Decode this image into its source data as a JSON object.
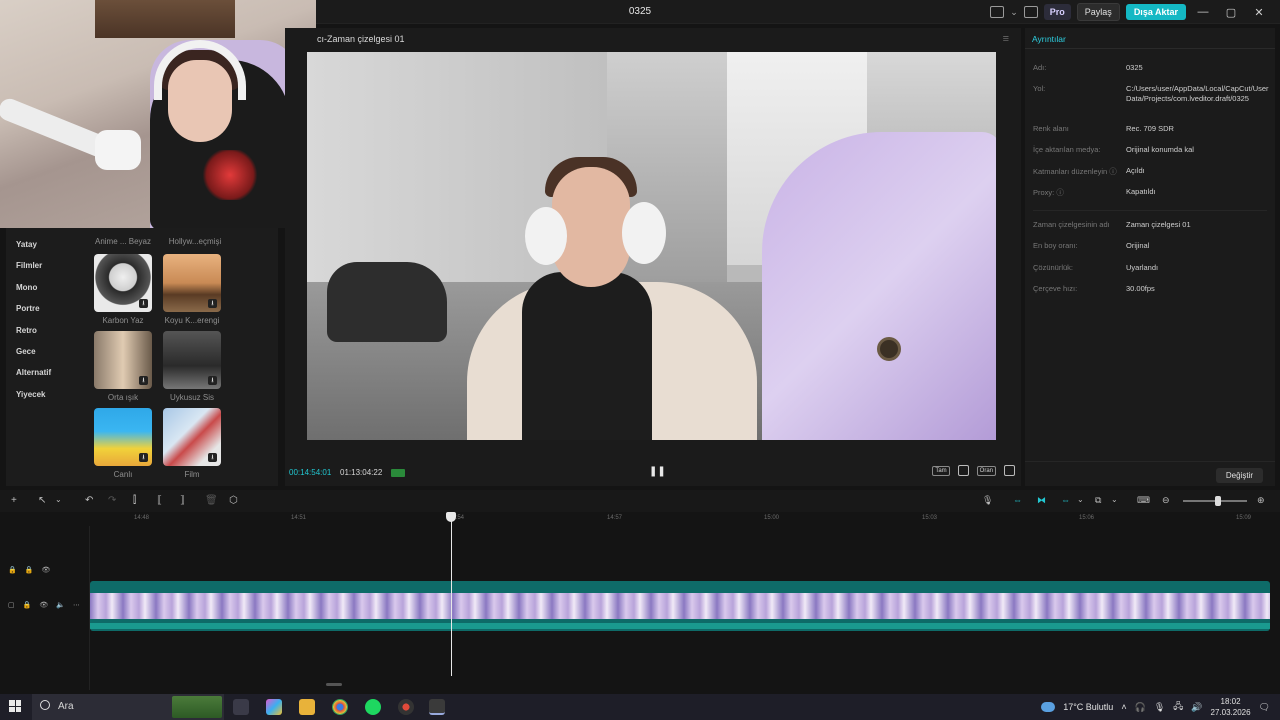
{
  "window": {
    "title": "0325",
    "pro_label": "Pro",
    "share_label": "Paylaş",
    "export_label": "Dışa Aktar",
    "minimize": "—",
    "maximize": "▢",
    "close": "✕"
  },
  "filters": {
    "categories": [
      "Yatay",
      "Filmler",
      "Mono",
      "Portre",
      "Retro",
      "Gece",
      "Alternatif",
      "Yiyecek"
    ],
    "top_labels": [
      "Anime ... Beyaz",
      "Hollyw...eçmişi"
    ],
    "items": [
      {
        "label": "Karbon Yaz",
        "download": "⭳"
      },
      {
        "label": "Koyu K...erengi",
        "download": "⭳"
      },
      {
        "label": "Orta ışık",
        "download": "⭳"
      },
      {
        "label": "Uykusuz Sis",
        "download": "⭳"
      },
      {
        "label": "Canlı",
        "download": "⭳"
      },
      {
        "label": "Film",
        "download": "⭳"
      }
    ]
  },
  "player": {
    "title": "cı-Zaman çizelgesi 01",
    "current_time": "00:14:54:01",
    "total_time": "01:13:04:22",
    "pause_icon": "❚❚",
    "controls": [
      "Tam",
      "Oran"
    ]
  },
  "details": {
    "title": "Ayrıntılar",
    "rows": [
      {
        "key": "Adı:",
        "value": "0325"
      },
      {
        "key": "Yol:",
        "value": "C:/Users/user/AppData/Local/CapCut/User Data/Projects/com.lveditor.draft/0325"
      },
      {
        "key": "Renk alanı",
        "value": "Rec. 709 SDR"
      },
      {
        "key": "İçe aktarılan medya:",
        "value": "Orijinal konumda kal"
      },
      {
        "key": "Katmanları düzenleyin ⓘ",
        "value": "Açıldı"
      },
      {
        "key": "Proxy: ⓘ",
        "value": "Kapatıldı"
      },
      {
        "key": "Zaman çizelgesinin adı",
        "value": "Zaman çizelgesi 01"
      },
      {
        "key": "En boy oranı:",
        "value": "Orijinal"
      },
      {
        "key": "Çözünürlük:",
        "value": "Uyarlandı"
      },
      {
        "key": "Çerçeve hızı:",
        "value": "30.00fps"
      }
    ],
    "change_label": "Değiştir"
  },
  "timeline": {
    "ticks": [
      "14:48",
      "14:51",
      "14:54",
      "14:57",
      "15:00",
      "15:03",
      "15:06",
      "15:09"
    ]
  },
  "taskbar": {
    "search_placeholder": "Ara",
    "weather": "17°C  Bulutlu",
    "time": "18:02",
    "date": "27.03.2026"
  }
}
